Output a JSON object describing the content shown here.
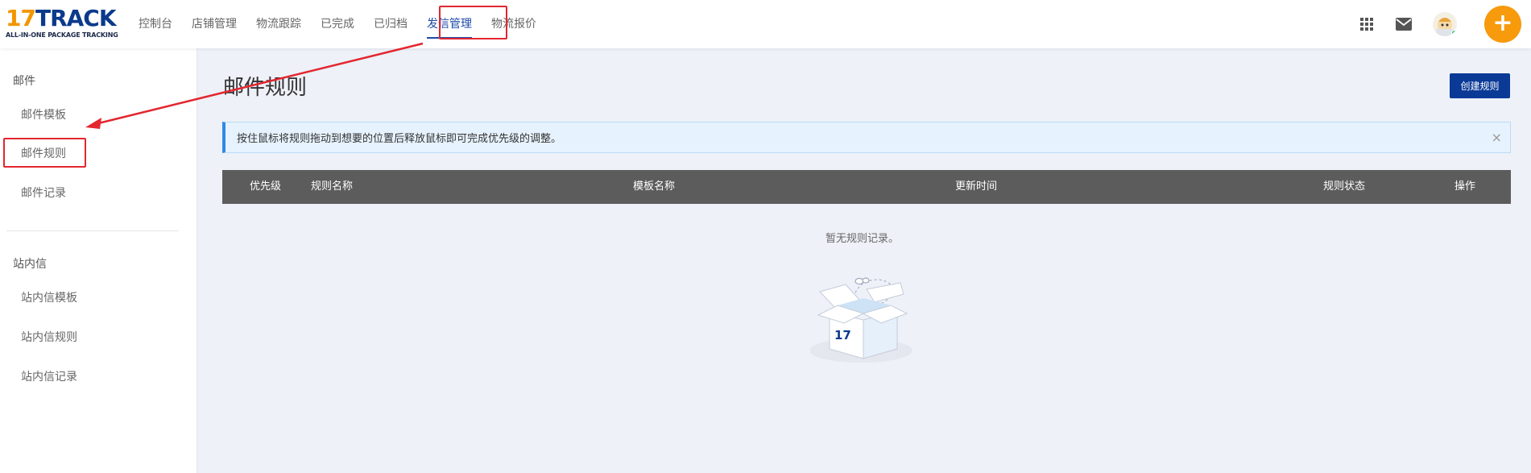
{
  "logo": {
    "num": "17",
    "word": "TRACK",
    "tagline": "ALL-IN-ONE PACKAGE TRACKING"
  },
  "nav": {
    "items": [
      {
        "label": "控制台"
      },
      {
        "label": "店铺管理"
      },
      {
        "label": "物流跟踪"
      },
      {
        "label": "已完成"
      },
      {
        "label": "已归档"
      },
      {
        "label": "发信管理",
        "active": true
      },
      {
        "label": "物流报价"
      }
    ]
  },
  "topright": {
    "apps_icon": "grid-icon",
    "mail_icon": "mail-icon",
    "add_label": "+"
  },
  "sidebar": {
    "groups": [
      {
        "title": "邮件",
        "items": [
          {
            "label": "邮件模板"
          },
          {
            "label": "邮件规则",
            "highlighted": true
          },
          {
            "label": "邮件记录"
          }
        ]
      },
      {
        "title": "站内信",
        "items": [
          {
            "label": "站内信模板"
          },
          {
            "label": "站内信规则"
          },
          {
            "label": "站内信记录"
          }
        ]
      }
    ]
  },
  "main": {
    "title": "邮件规则",
    "create_button": "创建规则",
    "alert": {
      "text": "按住鼠标将规则拖动到想要的位置后释放鼠标即可完成优先级的调整。",
      "close": "×"
    },
    "table": {
      "columns": [
        "优先级",
        "规则名称",
        "模板名称",
        "更新时间",
        "规则状态",
        "操作"
      ]
    },
    "empty": {
      "text": "暂无规则记录。",
      "box_label": "17"
    }
  },
  "colors": {
    "accent": "#0b3a96",
    "orange": "#f79a0c",
    "annotation": "#e3262f",
    "table_header": "#5c5c5c"
  }
}
